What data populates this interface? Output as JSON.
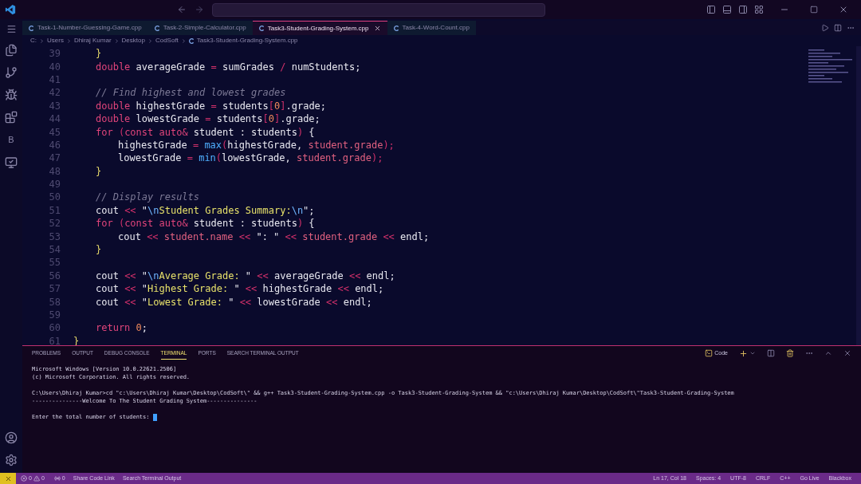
{
  "tabs": [
    {
      "label": "Task-1-Number-Guessing-Game.cpp",
      "selected": false
    },
    {
      "label": "Task-2-Simple-Calculator.cpp",
      "selected": false
    },
    {
      "label": "Task3-Student-Grading-System.cpp",
      "selected": true
    },
    {
      "label": "Task-4-Word-Count.cpp",
      "selected": false
    }
  ],
  "breadcrumb": [
    "C:",
    "Users",
    "Dhiraj Kumar",
    "Desktop",
    "CodSoft",
    "Task3-Student-Grading-System.cpp"
  ],
  "activity_items": [
    {
      "kind": "files"
    },
    {
      "kind": "branch"
    },
    {
      "kind": "debug"
    },
    {
      "kind": "extensions"
    },
    {
      "kind": "letter",
      "text": "B"
    },
    {
      "kind": "remote"
    }
  ],
  "editor": {
    "lines": [
      {
        "num": "39",
        "kind": "block",
        "tokens": [
          {
            "t": "}",
            "kind": "punct"
          }
        ]
      },
      {
        "num": "40",
        "kind": "block",
        "tokens": [
          {
            "t": "double",
            "kind": "kw"
          },
          {
            "t": " averageGrade ",
            "kind": "id"
          },
          {
            "t": "=",
            "kind": "op"
          },
          {
            "t": " sumGrades ",
            "kind": "id"
          },
          {
            "t": "/",
            "kind": "op"
          },
          {
            "t": " numStudents;",
            "kind": "id"
          }
        ]
      },
      {
        "num": "41",
        "kind": "block"
      },
      {
        "num": "42",
        "kind": "block",
        "tokens": [
          {
            "t": "// Find highest and lowest grades",
            "kind": "com"
          }
        ]
      },
      {
        "num": "43",
        "kind": "block",
        "tokens": [
          {
            "t": "double",
            "kind": "kw"
          },
          {
            "t": " highestGrade ",
            "kind": "id"
          },
          {
            "t": "=",
            "kind": "op"
          },
          {
            "t": " students",
            "kind": "id"
          },
          {
            "t": "[",
            "kind": "op"
          },
          {
            "t": "0",
            "kind": "num"
          },
          {
            "t": "]",
            "kind": "op"
          },
          {
            "t": ".grade;",
            "kind": "id"
          }
        ]
      },
      {
        "num": "44",
        "kind": "block",
        "tokens": [
          {
            "t": "double",
            "kind": "kw"
          },
          {
            "t": " lowestGrade ",
            "kind": "id"
          },
          {
            "t": "=",
            "kind": "op"
          },
          {
            "t": " students",
            "kind": "id"
          },
          {
            "t": "[",
            "kind": "op"
          },
          {
            "t": "0",
            "kind": "num"
          },
          {
            "t": "]",
            "kind": "op"
          },
          {
            "t": ".grade;",
            "kind": "id"
          }
        ]
      },
      {
        "num": "45",
        "kind": "block",
        "tokens": [
          {
            "t": "for",
            "kind": "kw"
          },
          {
            "t": " (",
            "kind": "op"
          },
          {
            "t": "const auto&",
            "kind": "kw"
          },
          {
            "t": " student : students",
            "kind": "id"
          },
          {
            "t": ")",
            "kind": "op"
          },
          {
            "t": " {",
            "kind": "id"
          }
        ]
      },
      {
        "num": "46",
        "kind": "nested",
        "tokens": [
          {
            "t": "highestGrade ",
            "kind": "id"
          },
          {
            "t": "= ",
            "kind": "op"
          },
          {
            "t": "max",
            "kind": "fn"
          },
          {
            "t": "(",
            "kind": "op"
          },
          {
            "t": "highestGrade, ",
            "kind": "id"
          },
          {
            "t": "student.grade",
            "kind": "mem"
          },
          {
            "t": ");",
            "kind": "op"
          }
        ]
      },
      {
        "num": "47",
        "kind": "nested",
        "tokens": [
          {
            "t": "lowestGrade ",
            "kind": "id"
          },
          {
            "t": "= ",
            "kind": "op"
          },
          {
            "t": "min",
            "kind": "fn"
          },
          {
            "t": "(",
            "kind": "op"
          },
          {
            "t": "lowestGrade, ",
            "kind": "id"
          },
          {
            "t": "student.grade",
            "kind": "mem"
          },
          {
            "t": ");",
            "kind": "op"
          }
        ]
      },
      {
        "num": "48",
        "kind": "block",
        "tokens": [
          {
            "t": "}",
            "kind": "punct"
          }
        ]
      },
      {
        "num": "49",
        "kind": "block"
      },
      {
        "num": "50",
        "kind": "block",
        "tokens": [
          {
            "t": "// Display results",
            "kind": "com"
          }
        ]
      },
      {
        "num": "51",
        "kind": "block",
        "tokens": [
          {
            "t": "cout ",
            "kind": "id"
          },
          {
            "t": "<<",
            "kind": "op"
          },
          {
            "t": " \"",
            "kind": "id"
          },
          {
            "t": "\\n",
            "kind": "esc"
          },
          {
            "t": "Student Grades Summary:",
            "kind": "str"
          },
          {
            "t": "\\n",
            "kind": "esc"
          },
          {
            "t": "\";",
            "kind": "id"
          }
        ]
      },
      {
        "num": "52",
        "kind": "block",
        "tokens": [
          {
            "t": "for",
            "kind": "kw"
          },
          {
            "t": " (",
            "kind": "op"
          },
          {
            "t": "const auto&",
            "kind": "kw"
          },
          {
            "t": " student : students",
            "kind": "id"
          },
          {
            "t": ")",
            "kind": "op"
          },
          {
            "t": " {",
            "kind": "id"
          }
        ]
      },
      {
        "num": "53",
        "kind": "nested",
        "tokens": [
          {
            "t": "cout ",
            "kind": "id"
          },
          {
            "t": "<<",
            "kind": "op"
          },
          {
            "t": " student.name ",
            "kind": "mem"
          },
          {
            "t": "<<",
            "kind": "op"
          },
          {
            "t": " \": \" ",
            "kind": "id"
          },
          {
            "t": "<<",
            "kind": "op"
          },
          {
            "t": " student.grade ",
            "kind": "mem"
          },
          {
            "t": "<<",
            "kind": "op"
          },
          {
            "t": " endl;",
            "kind": "id"
          }
        ]
      },
      {
        "num": "54",
        "kind": "block",
        "tokens": [
          {
            "t": "}",
            "kind": "punct"
          }
        ]
      },
      {
        "num": "55",
        "kind": "block"
      },
      {
        "num": "56",
        "kind": "block",
        "tokens": [
          {
            "t": "cout ",
            "kind": "id"
          },
          {
            "t": "<<",
            "kind": "op"
          },
          {
            "t": " \"",
            "kind": "id"
          },
          {
            "t": "\\n",
            "kind": "esc"
          },
          {
            "t": "Average Grade: ",
            "kind": "str"
          },
          {
            "t": "\" ",
            "kind": "id"
          },
          {
            "t": "<<",
            "kind": "op"
          },
          {
            "t": " averageGrade ",
            "kind": "id"
          },
          {
            "t": "<<",
            "kind": "op"
          },
          {
            "t": " endl;",
            "kind": "id"
          }
        ]
      },
      {
        "num": "57",
        "kind": "block",
        "tokens": [
          {
            "t": "cout ",
            "kind": "id"
          },
          {
            "t": "<<",
            "kind": "op"
          },
          {
            "t": " \"",
            "kind": "id"
          },
          {
            "t": "Highest Grade: ",
            "kind": "str"
          },
          {
            "t": "\" ",
            "kind": "id"
          },
          {
            "t": "<<",
            "kind": "op"
          },
          {
            "t": " highestGrade ",
            "kind": "id"
          },
          {
            "t": "<<",
            "kind": "op"
          },
          {
            "t": " endl;",
            "kind": "id"
          }
        ]
      },
      {
        "num": "58",
        "kind": "block",
        "tokens": [
          {
            "t": "cout ",
            "kind": "id"
          },
          {
            "t": "<<",
            "kind": "op"
          },
          {
            "t": " \"",
            "kind": "id"
          },
          {
            "t": "Lowest Grade: ",
            "kind": "str"
          },
          {
            "t": "\" ",
            "kind": "id"
          },
          {
            "t": "<<",
            "kind": "op"
          },
          {
            "t": " lowestGrade ",
            "kind": "id"
          },
          {
            "t": "<<",
            "kind": "op"
          },
          {
            "t": " endl;",
            "kind": "id"
          }
        ]
      },
      {
        "num": "59",
        "kind": "block"
      },
      {
        "num": "60",
        "kind": "block",
        "tokens": [
          {
            "t": "return",
            "kind": "kw"
          },
          {
            "t": " 0",
            "kind": "num"
          },
          {
            "t": ";",
            "kind": "id"
          }
        ]
      },
      {
        "num": "61",
        "kind": "top",
        "tokens": [
          {
            "t": "}",
            "kind": "punct"
          }
        ]
      }
    ]
  },
  "panel": {
    "tabs": [
      {
        "label": "PROBLEMS",
        "selected": false
      },
      {
        "label": "OUTPUT",
        "selected": false
      },
      {
        "label": "DEBUG CONSOLE",
        "selected": false
      },
      {
        "label": "TERMINAL",
        "selected": true
      },
      {
        "label": "PORTS",
        "selected": false
      },
      {
        "label": "SEARCH TERMINAL OUTPUT",
        "selected": false
      }
    ],
    "terminal_name": "Code",
    "terminal_blocks": [
      [
        "Microsoft Windows [Version 10.0.22621.2506]",
        "(c) Microsoft Corporation. All rights reserved."
      ],
      [
        "C:\\Users\\Dhiraj Kumar>cd \"c:\\Users\\Dhiraj Kumar\\Desktop\\CodSoft\\\" && g++ Task3-Student-Grading-System.cpp -o Task3-Student-Grading-System && \"c:\\Users\\Dhiraj Kumar\\Desktop\\CodSoft\\\"Task3-Student-Grading-System",
        "---------------Welcome To The Student Grading System---------------"
      ],
      [
        "Enter the total number of students:"
      ]
    ]
  },
  "status_bar": {
    "left": [
      {
        "kind": "errors",
        "errors": "0",
        "warnings": "0"
      },
      {
        "kind": "ports",
        "text": "0"
      },
      {
        "kind": "text",
        "text": "Share Code Link"
      },
      {
        "kind": "text",
        "text": "Search Terminal Output"
      }
    ],
    "right": [
      "Ln 17, Col 18",
      "Spaces: 4",
      "UTF-8",
      "CRLF",
      "C++",
      "Go Live",
      "Blackbox"
    ]
  }
}
